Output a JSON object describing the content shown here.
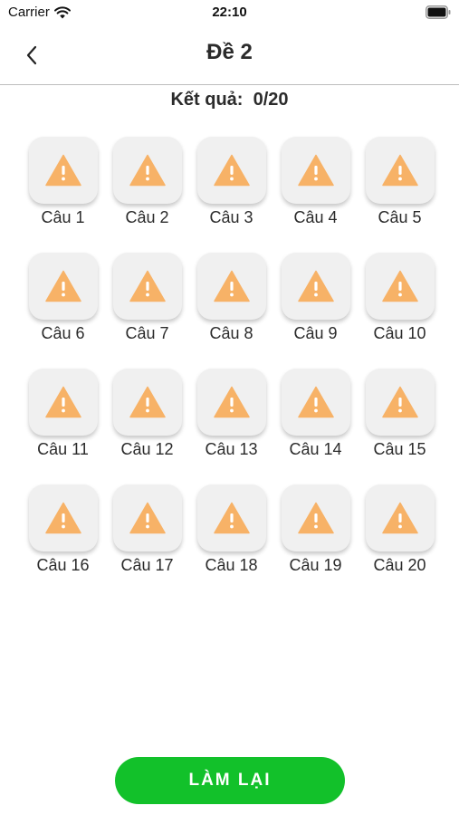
{
  "status_bar": {
    "carrier": "Carrier",
    "time": "22:10",
    "wifi_icon": "wifi-icon",
    "battery_icon": "battery-icon"
  },
  "nav": {
    "back_icon": "chevron-left-icon",
    "title": "Đề 2"
  },
  "result": {
    "text": "Kết quả:  0/20"
  },
  "questions": [
    {
      "label": "Câu 1",
      "status_icon": "warning-icon"
    },
    {
      "label": "Câu 2",
      "status_icon": "warning-icon"
    },
    {
      "label": "Câu 3",
      "status_icon": "warning-icon"
    },
    {
      "label": "Câu 4",
      "status_icon": "warning-icon"
    },
    {
      "label": "Câu 5",
      "status_icon": "warning-icon"
    },
    {
      "label": "Câu 6",
      "status_icon": "warning-icon"
    },
    {
      "label": "Câu 7",
      "status_icon": "warning-icon"
    },
    {
      "label": "Câu 8",
      "status_icon": "warning-icon"
    },
    {
      "label": "Câu 9",
      "status_icon": "warning-icon"
    },
    {
      "label": "Câu 10",
      "status_icon": "warning-icon"
    },
    {
      "label": "Câu 11",
      "status_icon": "warning-icon"
    },
    {
      "label": "Câu 12",
      "status_icon": "warning-icon"
    },
    {
      "label": "Câu 13",
      "status_icon": "warning-icon"
    },
    {
      "label": "Câu 14",
      "status_icon": "warning-icon"
    },
    {
      "label": "Câu 15",
      "status_icon": "warning-icon"
    },
    {
      "label": "Câu 16",
      "status_icon": "warning-icon"
    },
    {
      "label": "Câu 17",
      "status_icon": "warning-icon"
    },
    {
      "label": "Câu 18",
      "status_icon": "warning-icon"
    },
    {
      "label": "Câu 19",
      "status_icon": "warning-icon"
    },
    {
      "label": "Câu 20",
      "status_icon": "warning-icon"
    }
  ],
  "actions": {
    "redo_label": "LÀM LẠI"
  },
  "colors": {
    "accent_green": "#12c12a",
    "warning_orange": "#f7b267",
    "tile_background": "#f0f0f0"
  }
}
